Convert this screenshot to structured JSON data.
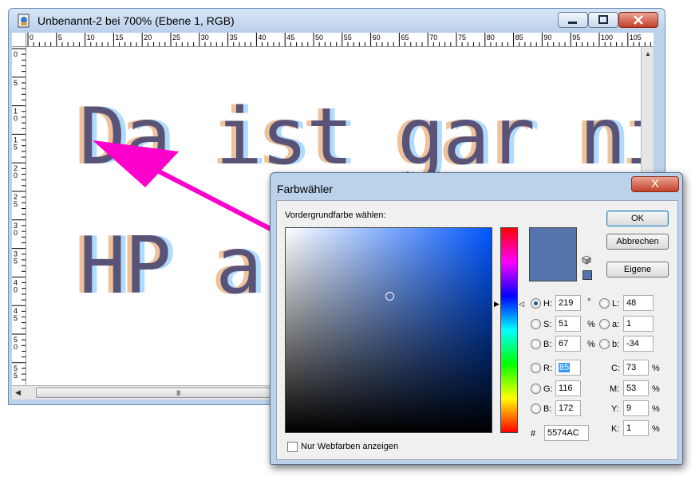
{
  "colors": {
    "current": "#5574AC",
    "annotation_arrow": "#ff00cc",
    "titlebar": "#bcd1ea",
    "close_button": "#c4402a"
  },
  "document": {
    "title": "Unbenannt-2 bei 700% (Ebene 1, RGB)",
    "app_icon": "photoshop-document-icon",
    "ruler_h_labels": [
      "0",
      "5",
      "10",
      "15",
      "20",
      "25",
      "30",
      "35",
      "40",
      "45",
      "50",
      "55",
      "60",
      "65",
      "70",
      "75",
      "80",
      "85",
      "90",
      "95",
      "100",
      "105"
    ],
    "ruler_v_labels": [
      "0",
      "5",
      "10",
      "15",
      "20",
      "25",
      "30",
      "35",
      "40",
      "45",
      "50",
      "55"
    ],
    "text_line1": "Da ist gar nich",
    "text_line2": "HP a",
    "hscroll_grip": "III"
  },
  "picker": {
    "title": "Farbwähler",
    "prompt": "Vordergrundfarbe wählen:",
    "close_label": "X",
    "buttons": {
      "ok": "OK",
      "cancel": "Abbrechen",
      "custom": "Eigene"
    },
    "hsb": {
      "h_label": "H:",
      "h": "219",
      "h_unit": "°",
      "s_label": "S:",
      "s": "51",
      "s_unit": "%",
      "b_label": "B:",
      "b": "67",
      "b_unit": "%"
    },
    "lab": {
      "l_label": "L:",
      "l": "48",
      "a_label": "a:",
      "a": "1",
      "b_label": "b:",
      "b": "-34"
    },
    "rgb": {
      "r_label": "R:",
      "r": "85",
      "g_label": "G:",
      "g": "116",
      "b_label": "B:",
      "b": "172"
    },
    "cmyk": {
      "c_label": "C:",
      "c": "73",
      "c_unit": "%",
      "m_label": "M:",
      "m": "53",
      "m_unit": "%",
      "y_label": "Y:",
      "y": "9",
      "y_unit": "%",
      "k_label": "K:",
      "k": "1",
      "k_unit": "%"
    },
    "hex_label": "#",
    "hex": "5574AC",
    "webcolors_label": "Nur Webfarben anzeigen"
  }
}
